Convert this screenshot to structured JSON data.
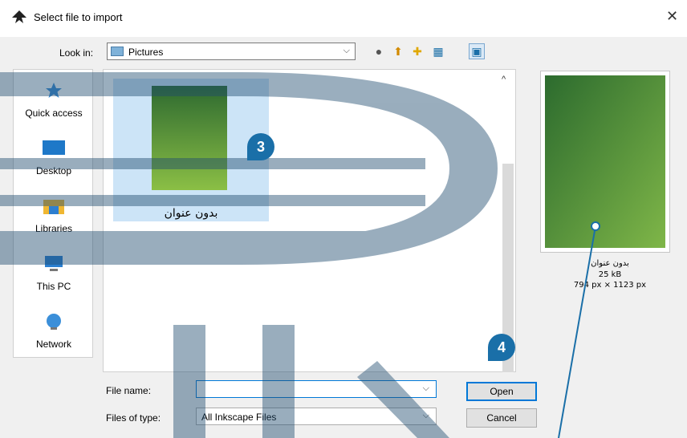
{
  "dialog": {
    "title": "Select file to import"
  },
  "toolbar": {
    "look_in_label": "Look in:",
    "look_in_value": "Pictures"
  },
  "places": [
    {
      "label": "Quick access",
      "icon": "star-icon"
    },
    {
      "label": "Desktop",
      "icon": "desktop-icon"
    },
    {
      "label": "Libraries",
      "icon": "libraries-icon"
    },
    {
      "label": "This PC",
      "icon": "computer-icon"
    },
    {
      "label": "Network",
      "icon": "network-icon"
    }
  ],
  "files": [
    {
      "name": "بدون عنوان"
    }
  ],
  "preview": {
    "name": "بدون عنوان",
    "size": "25 kB",
    "dimensions": "794 px × 1123 px"
  },
  "form": {
    "file_name_label": "File name:",
    "file_name_value": "",
    "files_of_type_label": "Files of type:",
    "files_of_type_value": "All Inkscape Files"
  },
  "buttons": {
    "open": "Open",
    "cancel": "Cancel"
  },
  "callouts": {
    "step3": "3",
    "step4": "4"
  },
  "colors": {
    "accent": "#0078d7",
    "badge": "#1a6fa8",
    "selection": "#cce4f7"
  }
}
